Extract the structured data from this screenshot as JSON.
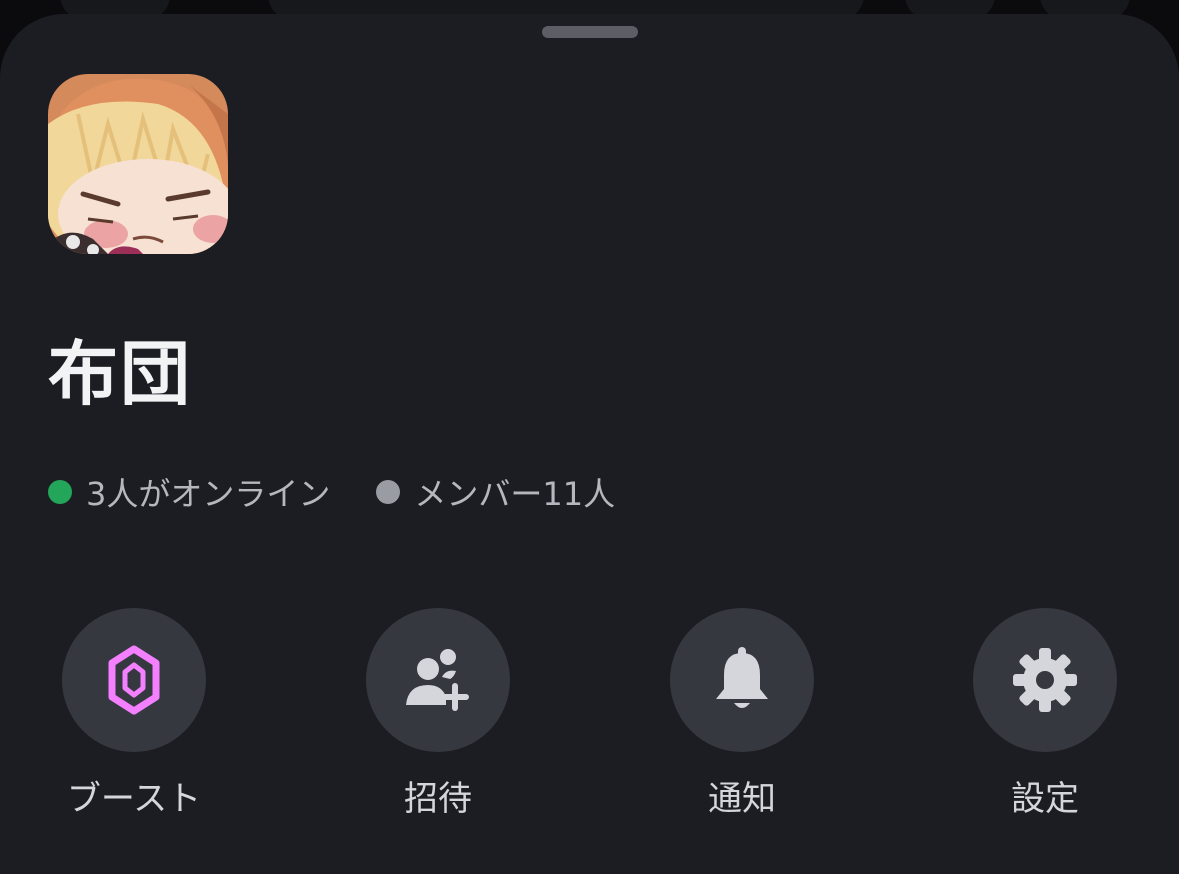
{
  "server": {
    "name": "布団",
    "icon": "anime-girl-server-icon"
  },
  "stats": {
    "online_text": "3人がオンライン",
    "online_color": "#23a55a",
    "members_text": "メンバー11人",
    "members_color": "#9a9ca3"
  },
  "actions": [
    {
      "label": "ブースト",
      "icon": "boost-gem-icon",
      "color": "#f47fff"
    },
    {
      "label": "招待",
      "icon": "add-user-icon",
      "color": "#d4d6dc"
    },
    {
      "label": "通知",
      "icon": "bell-icon",
      "color": "#d4d6dc"
    },
    {
      "label": "設定",
      "icon": "gear-icon",
      "color": "#d4d6dc"
    }
  ],
  "colors": {
    "sheet_background": "#1c1d22",
    "button_background": "#36383f",
    "title_text": "#f2f3f5",
    "secondary_text": "#b5b7be"
  }
}
